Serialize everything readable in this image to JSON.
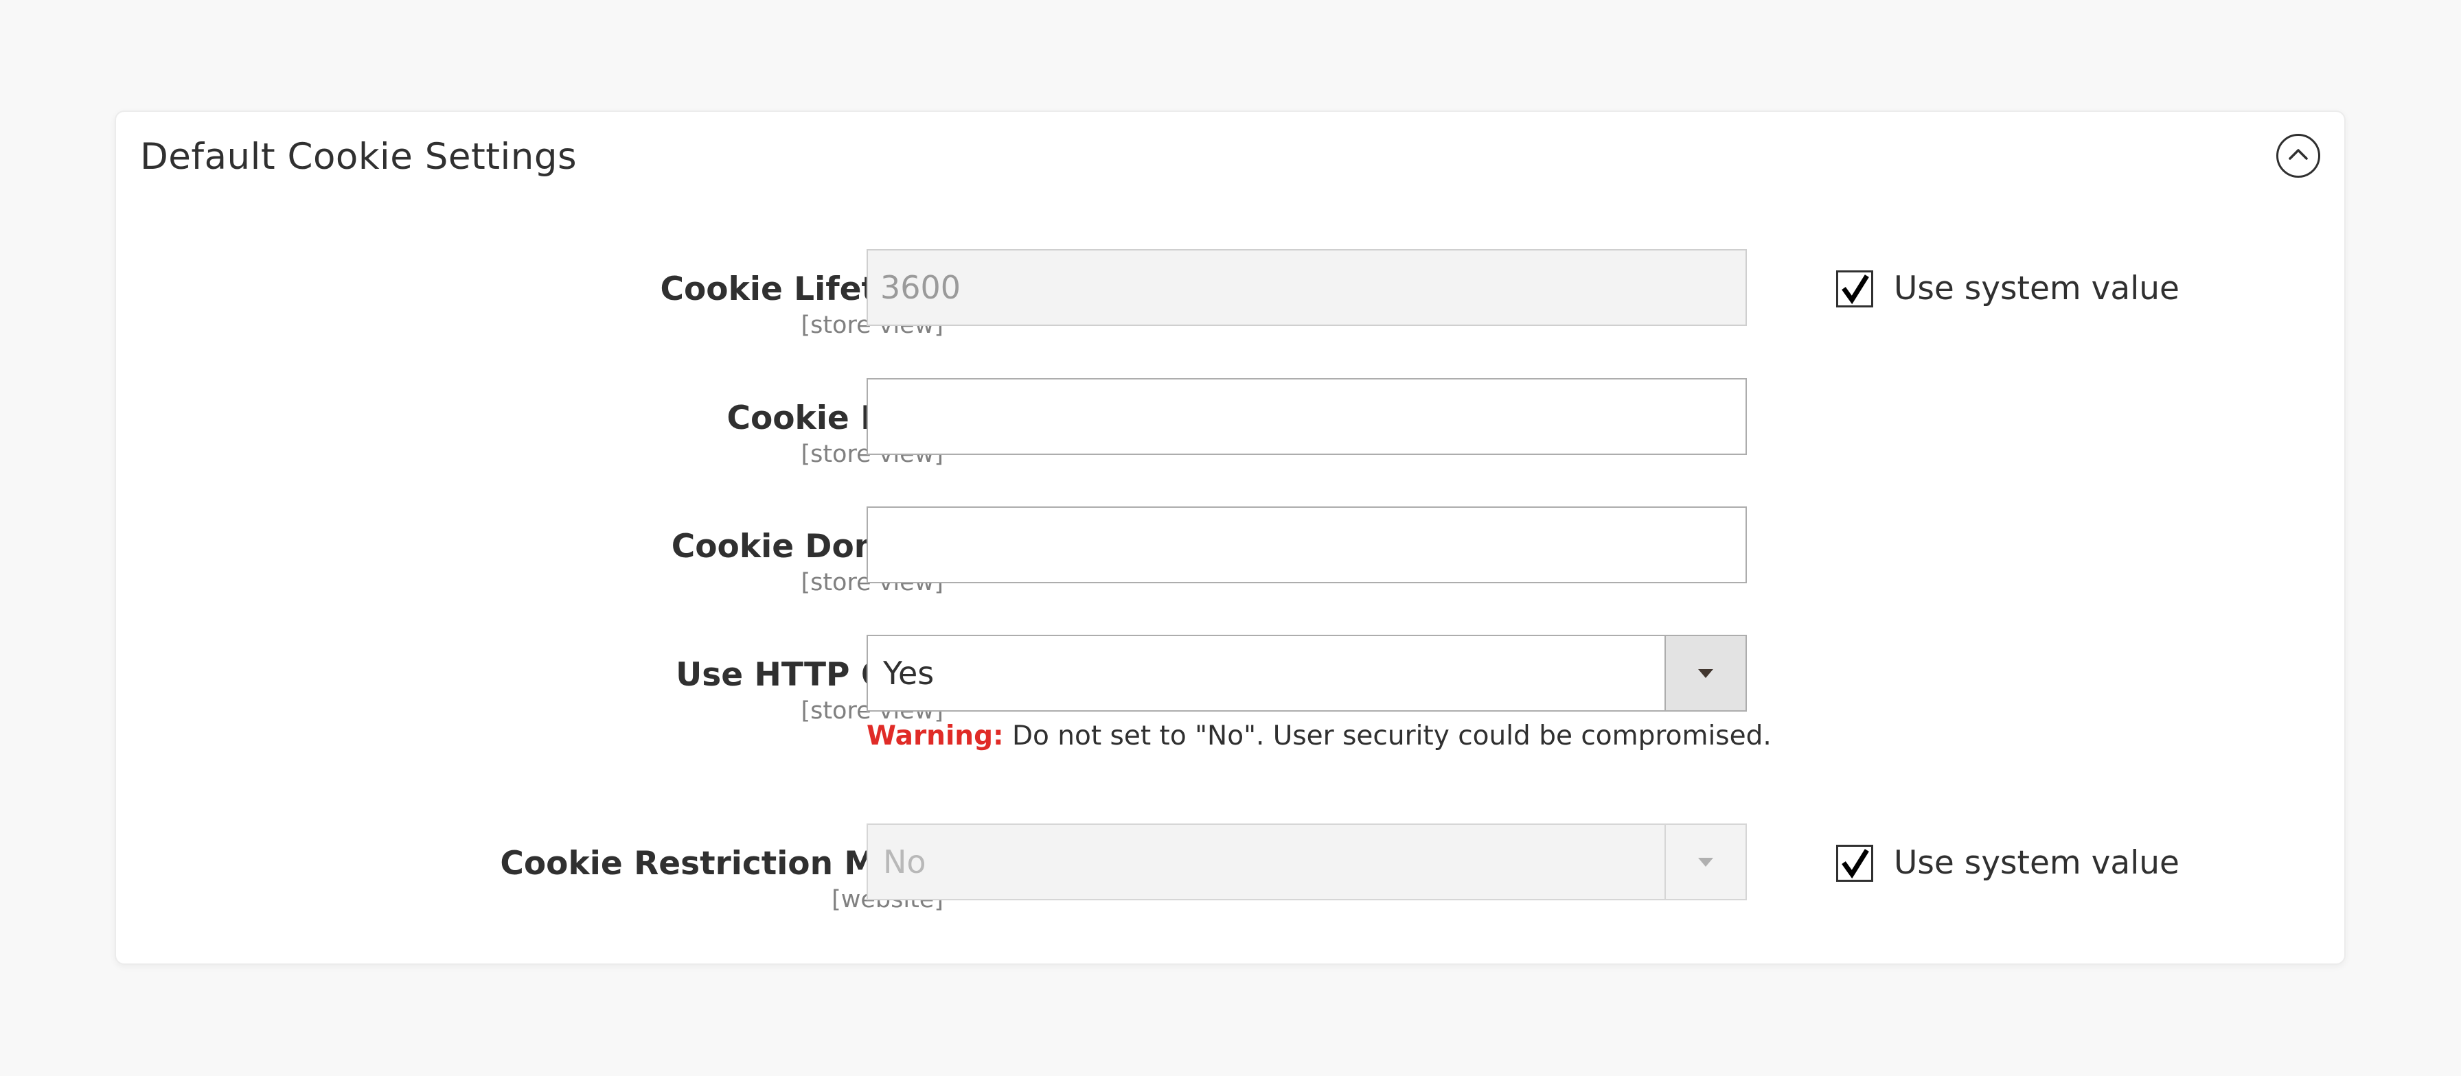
{
  "section": {
    "title": "Default Cookie Settings",
    "collapse_icon": "chevron-up-circle-icon"
  },
  "fields": {
    "cookie_lifetime": {
      "label": "Cookie Lifetime",
      "scope": "[store view]",
      "value": "3600",
      "disabled": true,
      "use_system_value": true,
      "use_system_value_label": "Use system value"
    },
    "cookie_path": {
      "label": "Cookie Path",
      "scope": "[store view]",
      "value": ""
    },
    "cookie_domain": {
      "label": "Cookie Domain",
      "scope": "[store view]",
      "value": ""
    },
    "use_http_only": {
      "label": "Use HTTP Only",
      "scope": "[store view]",
      "selected": "Yes",
      "warning_label": "Warning:",
      "warning_text": " Do not set to \"No\". User security could be compromised."
    },
    "cookie_restriction_mode": {
      "label": "Cookie Restriction Mode",
      "scope": "[website]",
      "selected": "No",
      "disabled": true,
      "use_system_value": true,
      "use_system_value_label": "Use system value"
    }
  },
  "colors": {
    "page_bg": "#f8f8f8",
    "panel_bg": "#ffffff",
    "warning": "#e02b27",
    "text": "#303030",
    "scope_text": "#808080"
  }
}
